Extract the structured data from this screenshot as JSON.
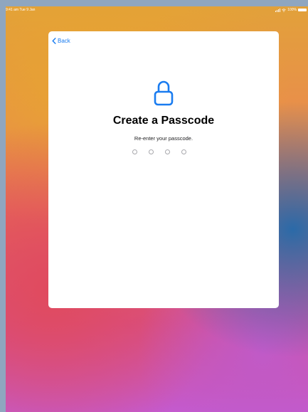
{
  "status_bar": {
    "time": "9:41 am",
    "date": "Tue 9 Jan",
    "battery_percent": "100%"
  },
  "sheet": {
    "back_label": "Back",
    "title": "Create a Passcode",
    "subtitle": "Re-enter your passcode."
  },
  "passcode": {
    "digits_total": 4,
    "digits_entered": 0
  },
  "colors": {
    "accent": "#1a7cf0"
  }
}
